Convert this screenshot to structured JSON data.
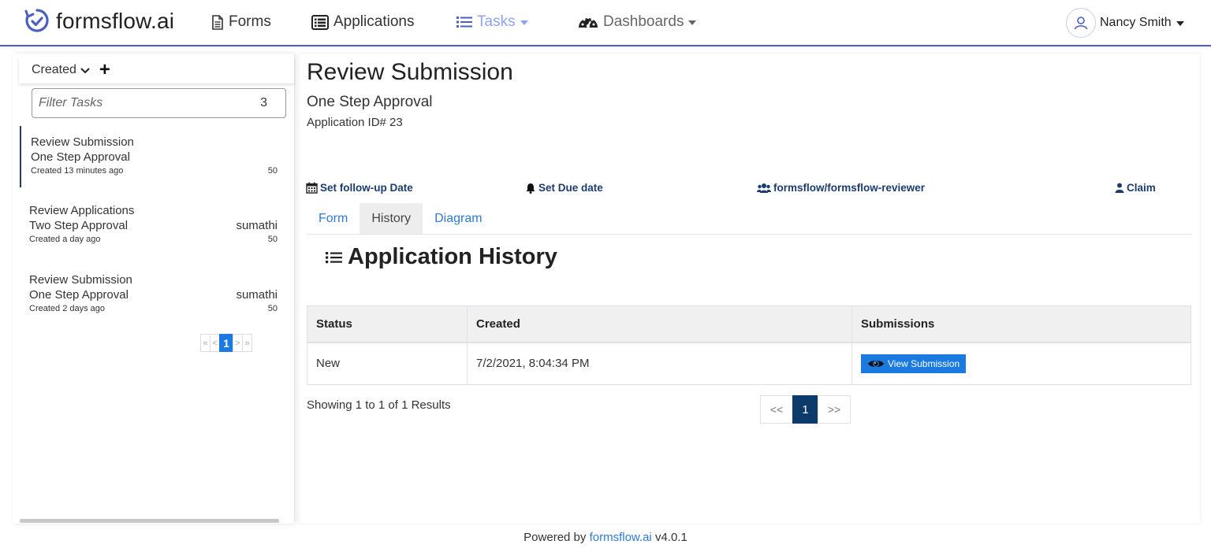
{
  "navbar": {
    "brand": "formsflow.ai",
    "items": [
      {
        "label": "Forms",
        "icon": "file-icon"
      },
      {
        "label": "Applications",
        "icon": "list-alt-icon"
      },
      {
        "label": "Tasks",
        "icon": "list-icon"
      },
      {
        "label": "Dashboards",
        "icon": "tachometer-icon"
      }
    ],
    "user": "Nancy Smith",
    "accent": "#4a5fc1",
    "active_color": "#8ea3f0"
  },
  "sidebar": {
    "sort_label": "Created",
    "filter_placeholder": "Filter Tasks",
    "filter_count": "3",
    "tasks": [
      {
        "title": "Review Submission",
        "subtitle": "One Step Approval",
        "assignee": "",
        "created": "Created 13 minutes ago",
        "priority": "50"
      },
      {
        "title": "Review Applications",
        "subtitle": "Two Step Approval",
        "assignee": "sumathi",
        "created": "Created a day ago",
        "priority": "50"
      },
      {
        "title": "Review Submission",
        "subtitle": "One Step Approval",
        "assignee": "sumathi",
        "created": "Created 2 days ago",
        "priority": "50"
      }
    ],
    "pager": {
      "first": "«",
      "prev": "<",
      "current": "1",
      "next": ">",
      "last": "»"
    }
  },
  "main": {
    "title": "Review Submission",
    "subtitle": "One Step Approval",
    "application_id": "Application ID# 23",
    "actions": {
      "followup": "Set follow-up Date",
      "due": "Set Due date",
      "group": "formsflow/formsflow-reviewer",
      "claim": "Claim"
    },
    "tabs": [
      "Form",
      "History",
      "Diagram"
    ],
    "active_tab": "History",
    "history_heading": "Application History",
    "table": {
      "headers": [
        "Status",
        "Created",
        "Submissions"
      ],
      "rows": [
        {
          "status": "New",
          "created": "7/2/2021, 8:04:34 PM",
          "action": "View Submission"
        }
      ]
    },
    "showing": "Showing 1 to 1 of 1 Results",
    "pager": {
      "first": "<<",
      "current": "1",
      "last": ">>"
    }
  },
  "footer": {
    "prefix": "Powered by",
    "link": "formsflow.ai",
    "version": "v4.0.1"
  }
}
